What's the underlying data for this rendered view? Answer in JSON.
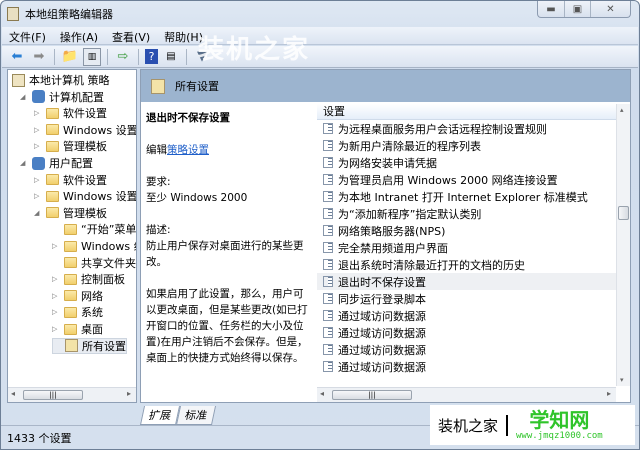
{
  "window": {
    "title": "本地组策略编辑器",
    "controls": [
      "minimize",
      "maximize",
      "close"
    ]
  },
  "menu": [
    "文件(F)",
    "操作(A)",
    "查看(V)",
    "帮助(H)"
  ],
  "watermark": "装机之家",
  "tree": [
    {
      "label": "本地计算机 策略",
      "level": 0,
      "arrow": ""
    },
    {
      "label": "计算机配置",
      "level": 1,
      "arrow": "◢"
    },
    {
      "label": "软件设置",
      "level": 2,
      "arrow": "▷"
    },
    {
      "label": "Windows 设置",
      "level": 2,
      "arrow": "▷"
    },
    {
      "label": "管理模板",
      "level": 2,
      "arrow": "▷"
    },
    {
      "label": "用户配置",
      "level": 1,
      "arrow": "◢"
    },
    {
      "label": "软件设置",
      "level": 2,
      "arrow": "▷"
    },
    {
      "label": "Windows 设置",
      "level": 2,
      "arrow": "▷"
    },
    {
      "label": "管理模板",
      "level": 2,
      "arrow": "◢"
    },
    {
      "label": "“开始”菜单",
      "level": 3,
      "arrow": ""
    },
    {
      "label": "Windows 组件",
      "level": 3,
      "arrow": "▷"
    },
    {
      "label": "共享文件夹",
      "level": 3,
      "arrow": ""
    },
    {
      "label": "控制面板",
      "level": 3,
      "arrow": "▷"
    },
    {
      "label": "网络",
      "level": 3,
      "arrow": "▷"
    },
    {
      "label": "系统",
      "level": 3,
      "arrow": "▷"
    },
    {
      "label": "桌面",
      "level": 3,
      "arrow": "▷"
    },
    {
      "label": "所有设置",
      "level": 3,
      "arrow": "",
      "selected": true
    }
  ],
  "header": {
    "title": "所有设置"
  },
  "description": {
    "title": "退出时不保存设置",
    "edit_prefix": "编辑",
    "edit_link": "策略设置",
    "req_label": "要求:",
    "req_value": "至少 Windows 2000",
    "desc_label": "描述:",
    "desc_text": "防止用户保存对桌面进行的某些更改。",
    "detail": "如果启用了此设置，那么，用户可以更改桌面，但是某些更改(如已打开窗口的位置、任务栏的大小及位置)在用户注销后不会保存。但是，桌面上的快捷方式始终得以保存。"
  },
  "list": {
    "column": "设置",
    "items": [
      "为远程桌面服务用户会话远程控制设置规则",
      "为新用户清除最近的程序列表",
      "为网络安装申请凭据",
      "为管理员启用 Windows 2000 网络连接设置",
      "为本地 Intranet 打开 Internet Explorer 标准模式",
      "为“添加新程序”指定默认类别",
      "网络策略服务器(NPS)",
      "完全禁用频道用户界面",
      "退出系统时清除最近打开的文档的历史",
      "退出时不保存设置",
      "同步运行登录脚本",
      "通过域访问数据源",
      "通过域访问数据源",
      "通过域访问数据源",
      "通过域访问数据源"
    ],
    "selected_index": 9
  },
  "tabs": [
    "扩展",
    "标准"
  ],
  "status": "1433 个设置",
  "brand": {
    "left": "装机之家",
    "name": "学知网",
    "url": "www.jmqz1000.com"
  }
}
